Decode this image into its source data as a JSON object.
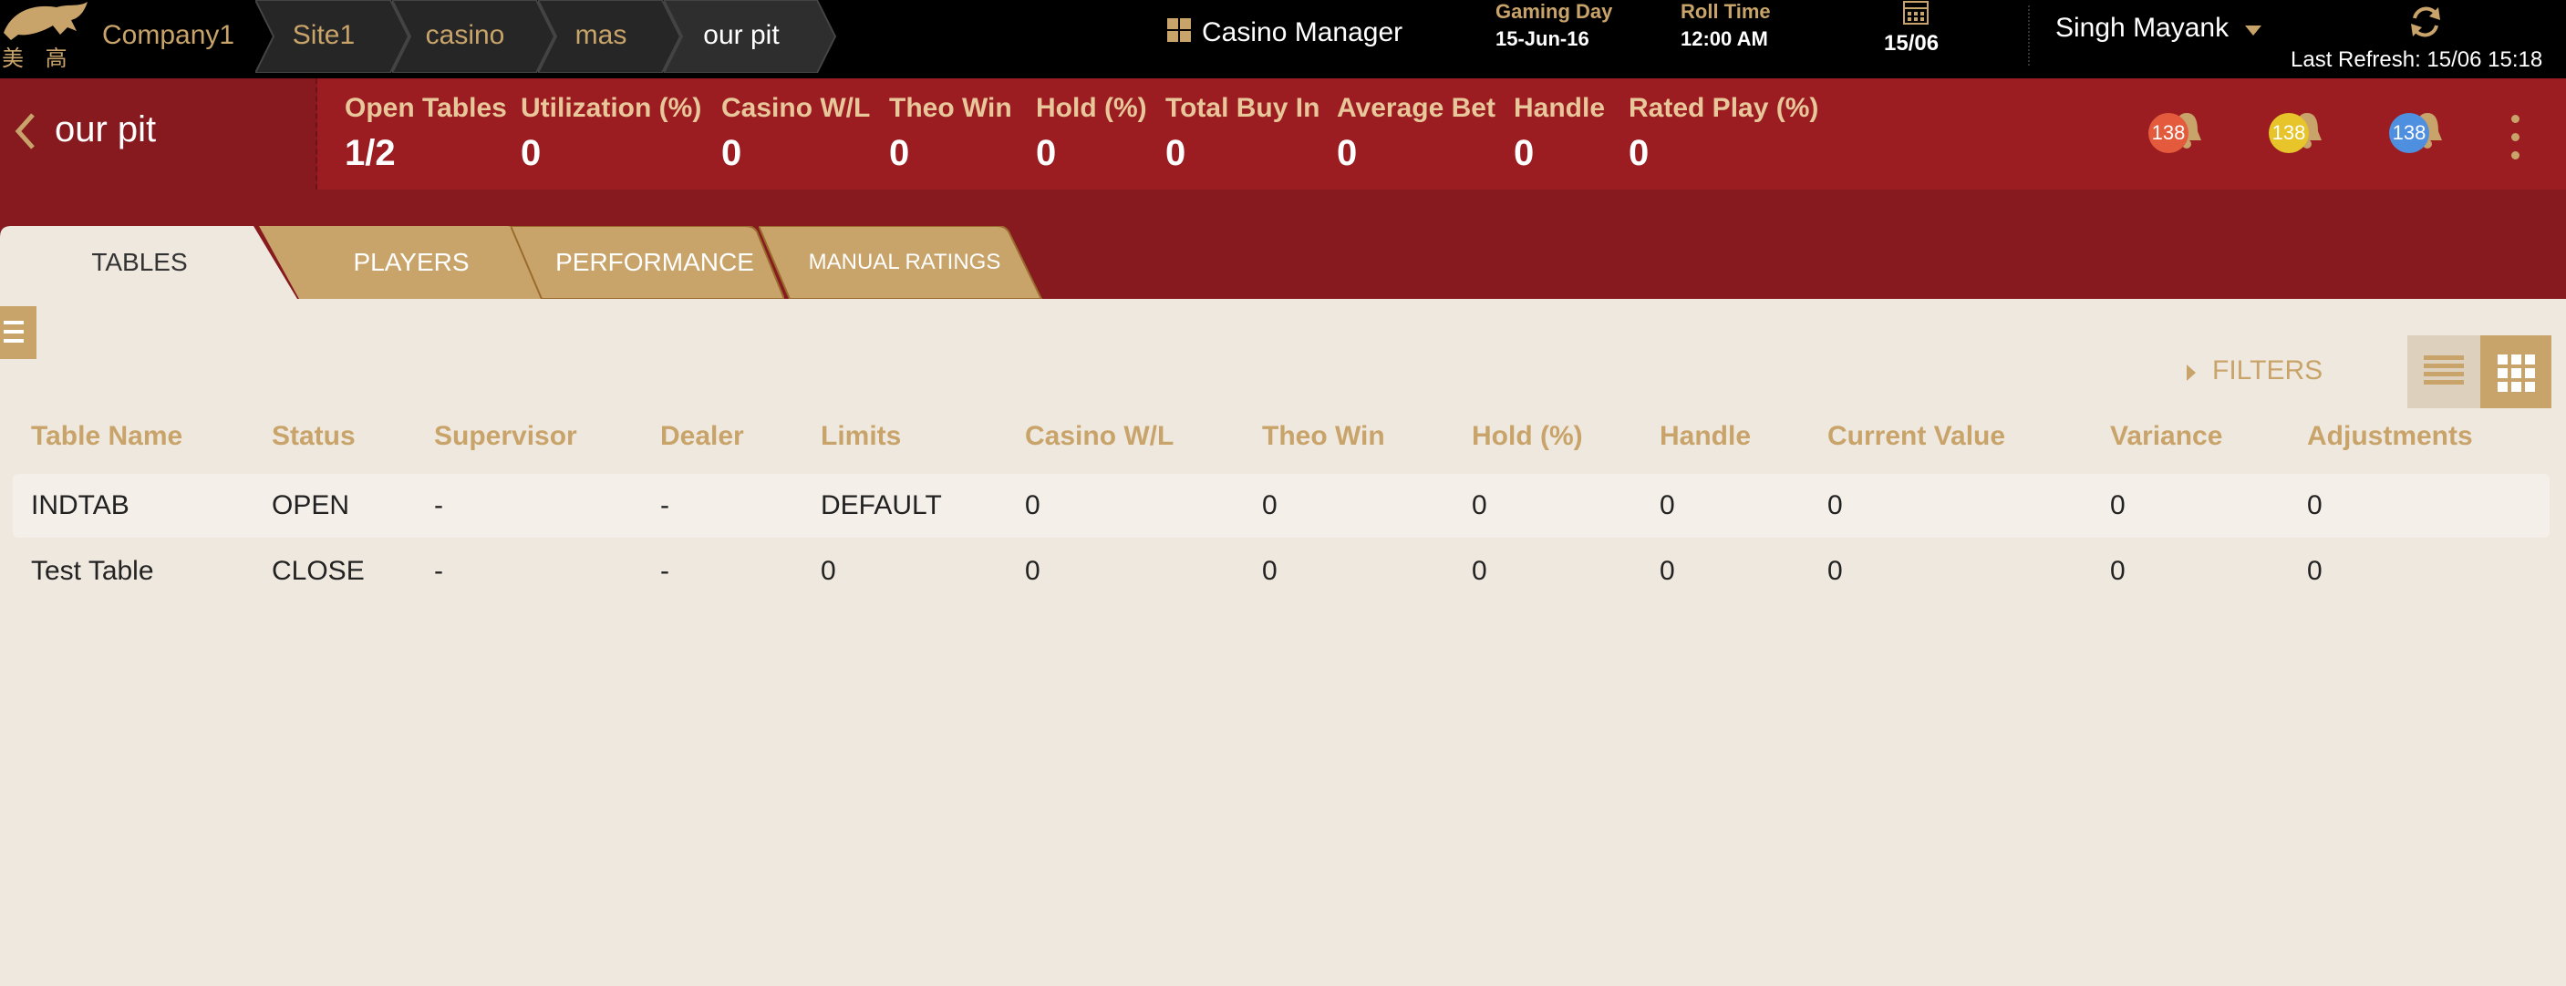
{
  "header": {
    "logo_text_cn": "美 高 梅",
    "breadcrumbs": [
      {
        "label": "Company1",
        "active": false
      },
      {
        "label": "Site1",
        "active": false
      },
      {
        "label": "casino",
        "active": false
      },
      {
        "label": "mas",
        "active": false
      },
      {
        "label": "our pit",
        "active": true
      }
    ],
    "app_title": "Casino Manager",
    "gaming_day_label": "Gaming Day",
    "gaming_day_value": "15-Jun-16",
    "roll_time_label": "Roll Time",
    "roll_time_value": "12:00 AM",
    "calendar_date": "15/06",
    "user_name": "Singh Mayank",
    "last_refresh": "Last Refresh: 15/06 15:18"
  },
  "summary": {
    "title": "our pit",
    "stats": [
      {
        "label": "Open Tables",
        "value": "1/2"
      },
      {
        "label": "Utilization (%)",
        "value": "0"
      },
      {
        "label": "Casino W/L",
        "value": "0"
      },
      {
        "label": "Theo Win",
        "value": "0"
      },
      {
        "label": "Hold (%)",
        "value": "0"
      },
      {
        "label": "Total Buy In",
        "value": "0"
      },
      {
        "label": "Average Bet",
        "value": "0"
      },
      {
        "label": "Handle",
        "value": "0"
      },
      {
        "label": "Rated Play (%)",
        "value": "0"
      }
    ],
    "alerts": [
      {
        "count": "138",
        "color": "#e35a3c"
      },
      {
        "count": "138",
        "color": "#e6c42a"
      },
      {
        "count": "138",
        "color": "#4f8fe0"
      }
    ]
  },
  "tabs": [
    {
      "label": "TABLES",
      "active": true
    },
    {
      "label": "PLAYERS",
      "active": false
    },
    {
      "label": "PERFORMANCE",
      "active": false
    },
    {
      "label": "MANUAL RATINGS",
      "active": false
    }
  ],
  "toolbar": {
    "filters_label": "FILTERS"
  },
  "table": {
    "columns": [
      "Table Name",
      "Status",
      "Supervisor",
      "Dealer",
      "Limits",
      "Casino W/L",
      "Theo Win",
      "Hold (%)",
      "Handle",
      "Current Value",
      "Variance",
      "Adjustments"
    ],
    "rows": [
      [
        "INDTAB",
        "OPEN",
        "-",
        "-",
        "DEFAULT",
        "0",
        "0",
        "0",
        "0",
        "0",
        "0",
        "0"
      ],
      [
        "Test Table",
        "CLOSE",
        "-",
        "-",
        "0",
        "0",
        "0",
        "0",
        "0",
        "0",
        "0",
        "0"
      ]
    ]
  },
  "colors": {
    "topbar": "#000000",
    "summary_bg": "#9b1d22",
    "tabstrip_bg": "#861a1f",
    "gold": "#c9a46a",
    "content_bg": "#efe8df"
  }
}
